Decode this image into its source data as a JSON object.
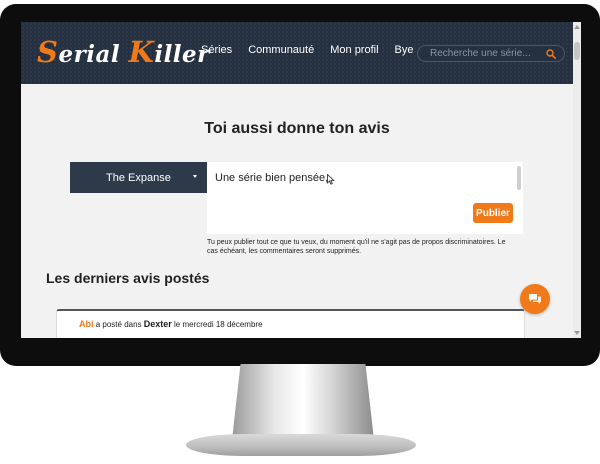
{
  "logo": {
    "first_initial": "S",
    "first_rest": "erial",
    "second_initial": "K",
    "second_rest": "iller"
  },
  "nav": {
    "links": [
      {
        "label": "Séries"
      },
      {
        "label": "Communauté"
      },
      {
        "label": "Mon profil"
      },
      {
        "label": "Bye"
      }
    ],
    "search_placeholder": "Recherche une série..."
  },
  "main": {
    "title": "Toi aussi donne ton avis",
    "series_select": {
      "selected": "The Expanse"
    },
    "review_text": "Une série bien pensée,",
    "publish_label": "Publier",
    "disclaimer": "Tu peux publier tout ce que tu veux, du moment qu'il ne s'agit pas de propos discriminatoires. Le cas échéant, les commentaires seront supprimés.",
    "latest_title": "Les derniers avis postés"
  },
  "latest_reviews": [
    {
      "author": "Abi",
      "posted_in": "a posté dans",
      "series": "Dexter",
      "date": "le mercredi 18 décembre"
    }
  ],
  "colors": {
    "accent": "#f07a1a",
    "navbar": "#253040",
    "select_bg": "#2d3a4a",
    "page_bg": "#f2f2f2"
  },
  "icons": {
    "search": "search-icon",
    "chat": "chat-bubbles-icon",
    "caret": "chevron-down-icon"
  }
}
